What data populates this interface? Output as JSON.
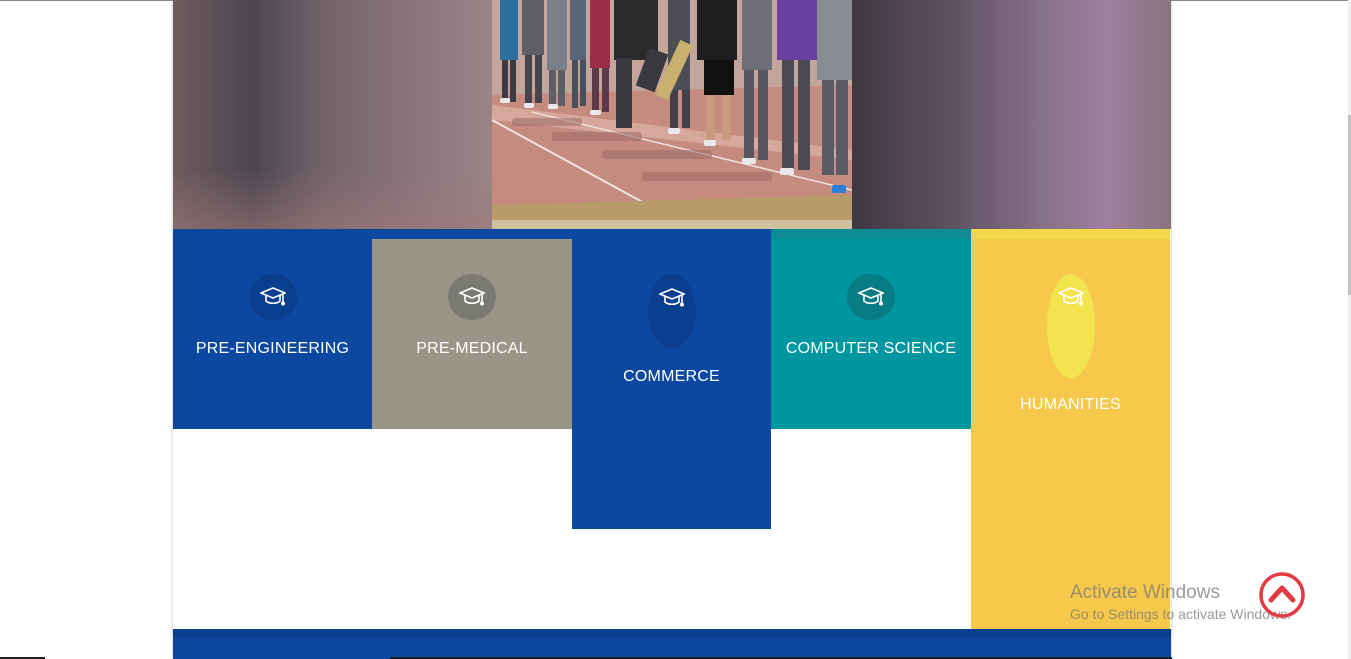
{
  "courses": [
    {
      "label": "PRE-ENGINEERING",
      "color": "#0d48a0",
      "icon": "graduation-cap-icon"
    },
    {
      "label": "PRE-MEDICAL",
      "color": "#999689",
      "icon": "graduation-cap-icon"
    },
    {
      "label": "COMMERCE",
      "color": "#0d48a0",
      "icon": "graduation-cap-icon"
    },
    {
      "label": "COMPUTER SCIENCE",
      "color": "#0096a0",
      "icon": "graduation-cap-icon"
    },
    {
      "label": "HUMANITIES",
      "color": "#f6c94d",
      "icon": "graduation-cap-icon"
    }
  ],
  "watermark": {
    "title": "Activate Windows",
    "subtitle": "Go to Settings to activate Windows."
  },
  "scroll_top": {
    "icon": "chevron-up-icon",
    "color": "#e23b44"
  }
}
